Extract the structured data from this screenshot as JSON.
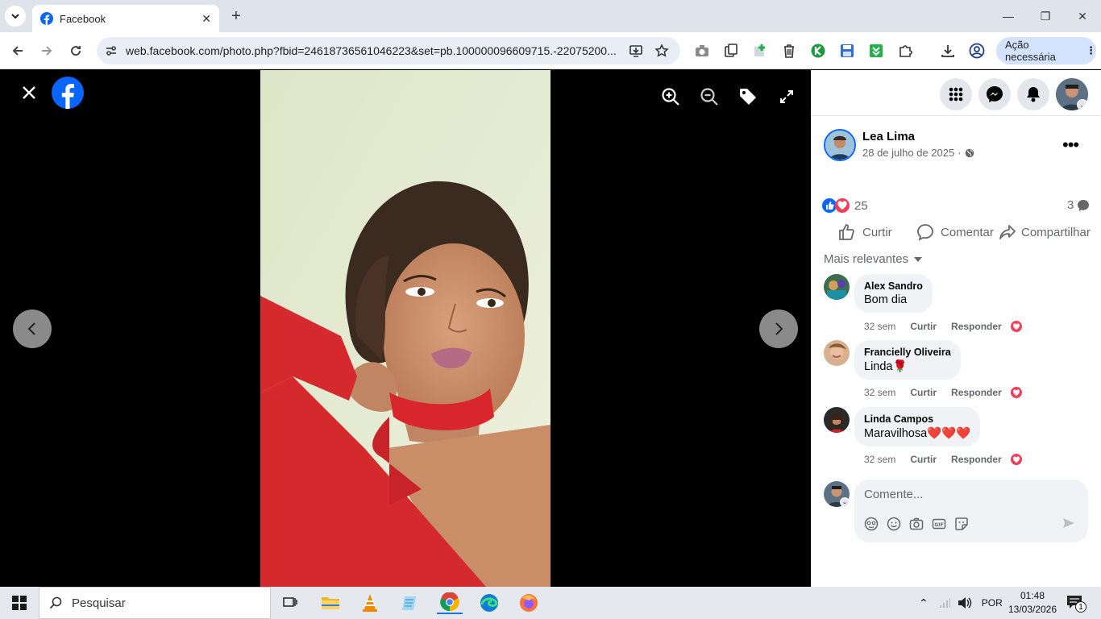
{
  "browser": {
    "tab_title": "Facebook",
    "url": "web.facebook.com/photo.php?fbid=24618736561046223&set=pb.100000096609715.-22075200...",
    "profile_action": "Ação necessária"
  },
  "post": {
    "author": "Lea Lima",
    "date": "28 de julho de 2025",
    "date_sep": "·",
    "reactions_count": "25",
    "comments_count": "3",
    "actions": {
      "like": "Curtir",
      "comment": "Comentar",
      "share": "Compartilhar"
    },
    "sort_label": "Mais relevantes"
  },
  "comments": [
    {
      "name": "Alex Sandro",
      "text": "Bom dia",
      "time": "32 sem",
      "like": "Curtir",
      "reply": "Responder"
    },
    {
      "name": "Francielly Oliveira",
      "text": "Linda🌹",
      "time": "32 sem",
      "like": "Curtir",
      "reply": "Responder"
    },
    {
      "name": "Linda Campos",
      "text": "Maravilhosa❤️❤️❤️",
      "time": "32 sem",
      "like": "Curtir",
      "reply": "Responder"
    }
  ],
  "composer": {
    "placeholder": "Comente..."
  },
  "taskbar": {
    "search_placeholder": "Pesquisar",
    "language": "POR",
    "time": "01:48",
    "date": "13/03/2026",
    "notif_count": "1"
  },
  "colors": {
    "fb_blue": "#0866ff",
    "reaction_red": "#f33e58",
    "dress_red": "#d42a2e"
  }
}
